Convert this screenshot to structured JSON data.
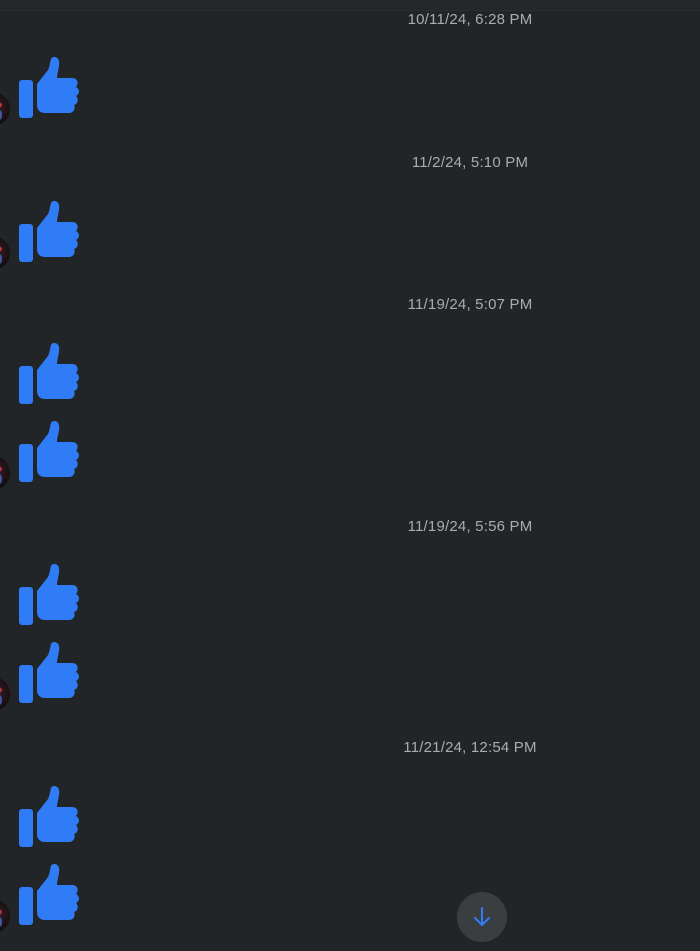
{
  "conversation": {
    "groups": [
      {
        "timestamp": "10/11/24, 6:28 PM",
        "reactions": [
          "thumbs-up"
        ]
      },
      {
        "timestamp": "11/2/24, 5:10 PM",
        "reactions": [
          "thumbs-up"
        ]
      },
      {
        "timestamp": "11/19/24, 5:07 PM",
        "reactions": [
          "thumbs-up",
          "thumbs-up"
        ]
      },
      {
        "timestamp": "11/19/24, 5:56 PM",
        "reactions": [
          "thumbs-up",
          "thumbs-up"
        ]
      },
      {
        "timestamp": "11/21/24, 12:54 PM",
        "reactions": [
          "thumbs-up",
          "thumbs-up"
        ]
      }
    ]
  },
  "scroll_button": {
    "icon": "arrow-down-icon"
  },
  "colors": {
    "background": "#222527",
    "like_blue": "#2f7cf6",
    "timestamp_text": "#a9acb0",
    "scroll_button_bg": "#3b3e41"
  }
}
